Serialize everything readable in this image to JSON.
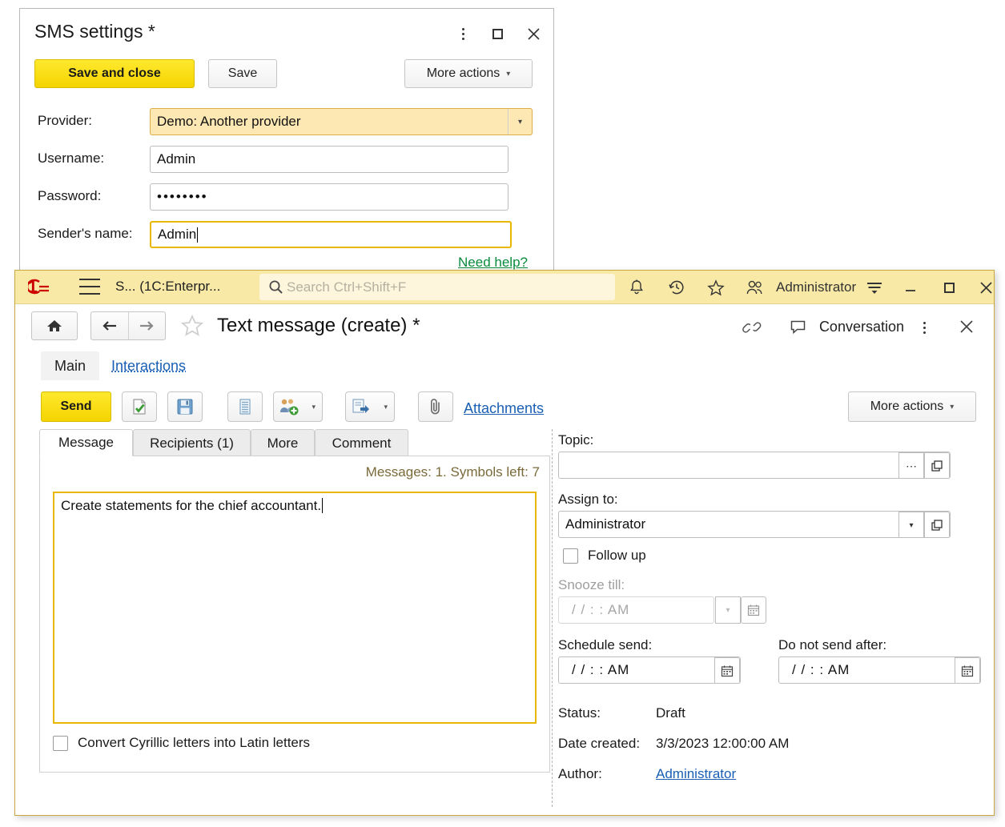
{
  "sms_dialog": {
    "title": "SMS settings *",
    "window_controls": {
      "kebab": "more-options",
      "maximize": "maximize",
      "close": "close"
    },
    "toolbar": {
      "save_and_close": "Save and close",
      "save": "Save",
      "more_actions": "More actions"
    },
    "fields": {
      "provider_label": "Provider:",
      "provider_value": "Demo: Another provider",
      "username_label": "Username:",
      "username_value": "Admin",
      "password_label": "Password:",
      "password_value": "••••••••",
      "sender_label": "Sender's name:",
      "sender_value": "Admin"
    },
    "help_link": "Need help?"
  },
  "onec": {
    "titlebar": {
      "logo": "1C",
      "app_title": "S...  (1C:Enterpr...",
      "search_placeholder": "Search Ctrl+Shift+F",
      "user": "Administrator",
      "icons": [
        "bell-icon",
        "history-icon",
        "star-icon",
        "users-icon",
        "filter-icon",
        "minimize-icon",
        "maximize-icon",
        "close-icon"
      ]
    },
    "form_header": {
      "title": "Text message (create) *",
      "conversation": "Conversation"
    },
    "nav_tabs": [
      {
        "label": "Main",
        "active": true
      },
      {
        "label": "Interactions",
        "active": false
      }
    ],
    "command_bar": {
      "send": "Send",
      "attachments": "Attachments",
      "more_actions": "More actions",
      "icons": [
        "post-document-icon",
        "save-icon",
        "register-icon",
        "add-recipients-icon",
        "forward-icon",
        "paperclip-icon"
      ]
    },
    "message_panel": {
      "tabs": [
        {
          "label": "Message",
          "active": true
        },
        {
          "label": "Recipients (1)",
          "active": false
        },
        {
          "label": "More",
          "active": false
        },
        {
          "label": "Comment",
          "active": false
        }
      ],
      "counter": "Messages: 1. Symbols left: 7",
      "body": "Create statements for the chief accountant.",
      "convert_checkbox_label": "Convert Cyrillic letters into Latin letters",
      "convert_checked": false
    },
    "details": {
      "topic_label": "Topic:",
      "topic_value": "",
      "assign_to_label": "Assign to:",
      "assign_to_value": "Administrator",
      "follow_up_label": "Follow up",
      "follow_up_checked": false,
      "snooze_label": "Snooze till:",
      "snooze_value": "/ /      :  :     AM",
      "schedule_send_label": "Schedule send:",
      "schedule_send_value": "/ /      :  :    AM",
      "do_not_send_after_label": "Do not send after:",
      "do_not_send_after_value": "/ /      :  :    AM",
      "status_label": "Status:",
      "status_value": "Draft",
      "date_created_label": "Date created:",
      "date_created_value": "3/3/2023 12:00:00 AM",
      "author_label": "Author:",
      "author_value": "Administrator"
    }
  },
  "colors": {
    "brand_yellow": "#f4d400",
    "titlebar_yellow": "#f8e9a6",
    "search_cream": "#fdf6dc",
    "focus_gold": "#e9b600",
    "link_blue": "#1a5fb4",
    "help_green": "#0a8a3c",
    "window_border_gold": "#c9a83e",
    "field_highlight": "#fde8b4"
  }
}
